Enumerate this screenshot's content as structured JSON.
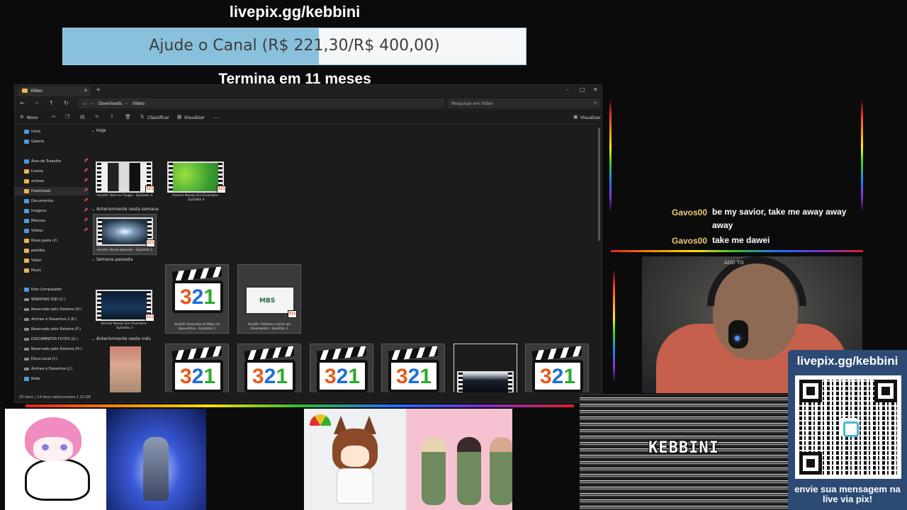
{
  "overlay": {
    "livepix_top": "livepix.gg/kebbini",
    "goal_text": "Ajude o Canal (R$ 221,30/R$ 400,00)",
    "goal_current": 221.3,
    "goal_target": 400.0,
    "goal_ends": "Termina em 11 meses"
  },
  "explorer": {
    "tab_title": "Vídeo",
    "breadcrumb": [
      "Downloads",
      "Vídeo"
    ],
    "search_placeholder": "Pesquisar em Vídeo",
    "toolbar": {
      "new": "Novo",
      "sort": "Classificar",
      "view": "Visualizar",
      "more": "...",
      "details": "Visualizar"
    },
    "nav_items": [
      {
        "label": "Início",
        "icon": "home-icon"
      },
      {
        "label": "Galeria",
        "icon": "gallery-icon"
      },
      {
        "label": "Área de Trabalho",
        "icon": "desktop-icon"
      },
      {
        "label": "Liveira",
        "icon": "folder-icon"
      },
      {
        "label": "animes",
        "icon": "folder-icon"
      },
      {
        "label": "Downloads",
        "icon": "download-icon"
      },
      {
        "label": "Documentos",
        "icon": "documents-icon"
      },
      {
        "label": "Imagens",
        "icon": "pictures-icon"
      },
      {
        "label": "Músicas",
        "icon": "music-icon"
      },
      {
        "label": "Vídeos",
        "icon": "videos-icon"
      },
      {
        "label": "Nova pasta (2)",
        "icon": "folder-icon"
      },
      {
        "label": "pedidos",
        "icon": "folder-icon"
      },
      {
        "label": "Vídeo",
        "icon": "folder-icon"
      },
      {
        "label": "Music",
        "icon": "folder-icon"
      },
      {
        "label": "Este Computador",
        "icon": "computer-icon"
      },
      {
        "label": "WINDOWS SSD (C:)",
        "icon": "drive-icon"
      },
      {
        "label": "Reservado pelo Sistema (D:)",
        "icon": "drive-icon"
      },
      {
        "label": "Animes e Desenhos 2 (E:)",
        "icon": "drive-icon"
      },
      {
        "label": "Reservado pelo Sistema (F:)",
        "icon": "drive-icon"
      },
      {
        "label": "DOCUMENTOS FOTOS (G:)",
        "icon": "drive-icon"
      },
      {
        "label": "Reservado pelo Sistema (H:)",
        "icon": "drive-icon"
      },
      {
        "label": "Disco Local (I:)",
        "icon": "drive-icon"
      },
      {
        "label": "Animes e Desenhos (J:)",
        "icon": "drive-icon"
      },
      {
        "label": "Rede",
        "icon": "network-icon"
      }
    ],
    "groups": {
      "today": "Hoje",
      "earlier_week": "Anteriormente nesta semana",
      "last_week": "Semana passada",
      "earlier_month": "Anteriormente neste mês"
    },
    "files": [
      "Assistir Yomi no Tsugai - Episódio 4",
      "Assistir Needy Girl Overdose - Episódio 4",
      "Assistir Akane-banashi - Episódio 1",
      "Assistir Needy Girl Overdose - Episódio 3",
      "Assistir Kuroneko to Majo no Kyoushitsu - Episódio 1",
      "Assistir Aishiteru Game wo Owarasetai - Episódio 1"
    ],
    "status": "25 itens  |  14 itens selecionados  1,10 GB"
  },
  "chat": {
    "messages": [
      {
        "user": "Gavos00",
        "text": "be my savior, take me away away away"
      },
      {
        "user": "Gavos00",
        "text": "take me dawei"
      }
    ]
  },
  "webcam": {
    "label": "ADD TO"
  },
  "qr": {
    "title": "livepix.gg/kebbini",
    "caption": "envie sua mensagem na live via pix!"
  },
  "bottom": {
    "static_label": "KEBBINI"
  },
  "colors": {
    "goal_fill": "#89c1dd",
    "chat_user": "#f0c878",
    "qr_panel": "#2c4a73"
  }
}
